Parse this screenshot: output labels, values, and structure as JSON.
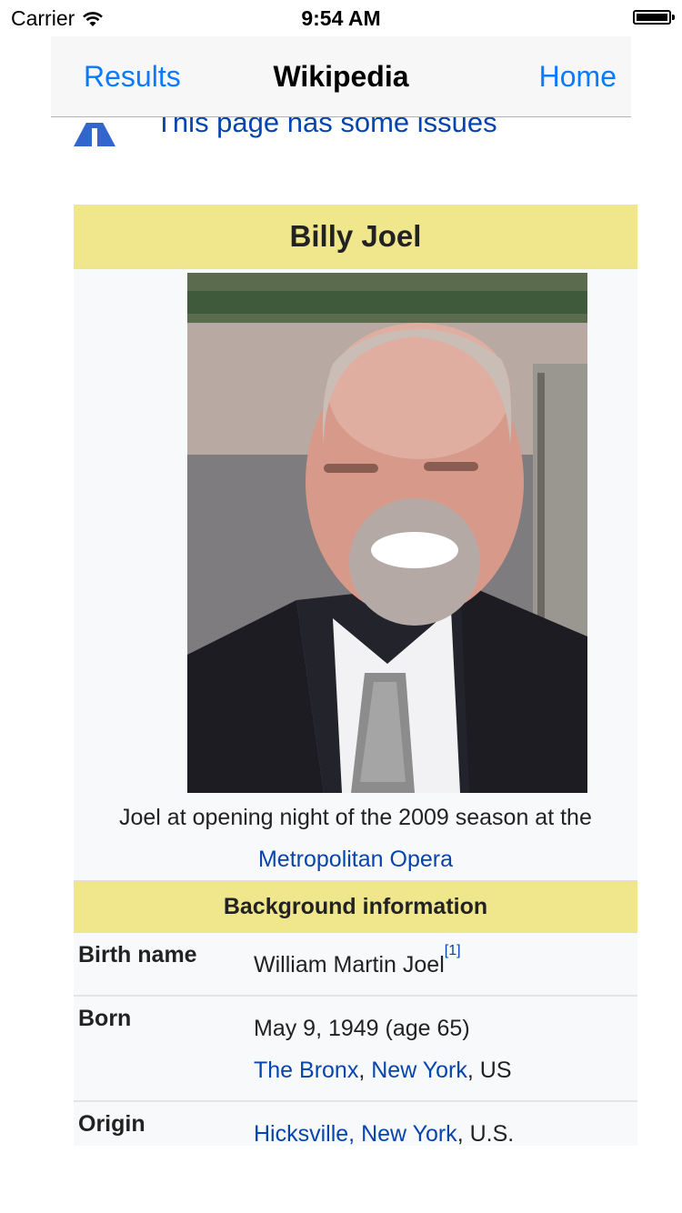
{
  "status_bar": {
    "carrier": "Carrier",
    "time": "9:54 AM",
    "battery_level": 1.0
  },
  "nav": {
    "left_label": "Results",
    "title": "Wikipedia",
    "right_label": "Home"
  },
  "issue": {
    "text": "This page has some issues"
  },
  "infobox": {
    "title": "Billy Joel",
    "caption_line1": "Joel at opening night of the 2009 season at the",
    "caption_link": "Metropolitan Opera",
    "section_header": "Background information",
    "birth_name": {
      "label": "Birth name",
      "value": "William Martin Joel",
      "ref": "[1]"
    },
    "born": {
      "label": "Born",
      "date": "May 9, 1949 (age 65)",
      "place_link1": "The Bronx",
      "sep1": ", ",
      "place_link2": "New York",
      "place_suffix": ", US"
    },
    "origin": {
      "label": "Origin",
      "link": "Hicksville, New York",
      "suffix": ", U.S."
    }
  }
}
